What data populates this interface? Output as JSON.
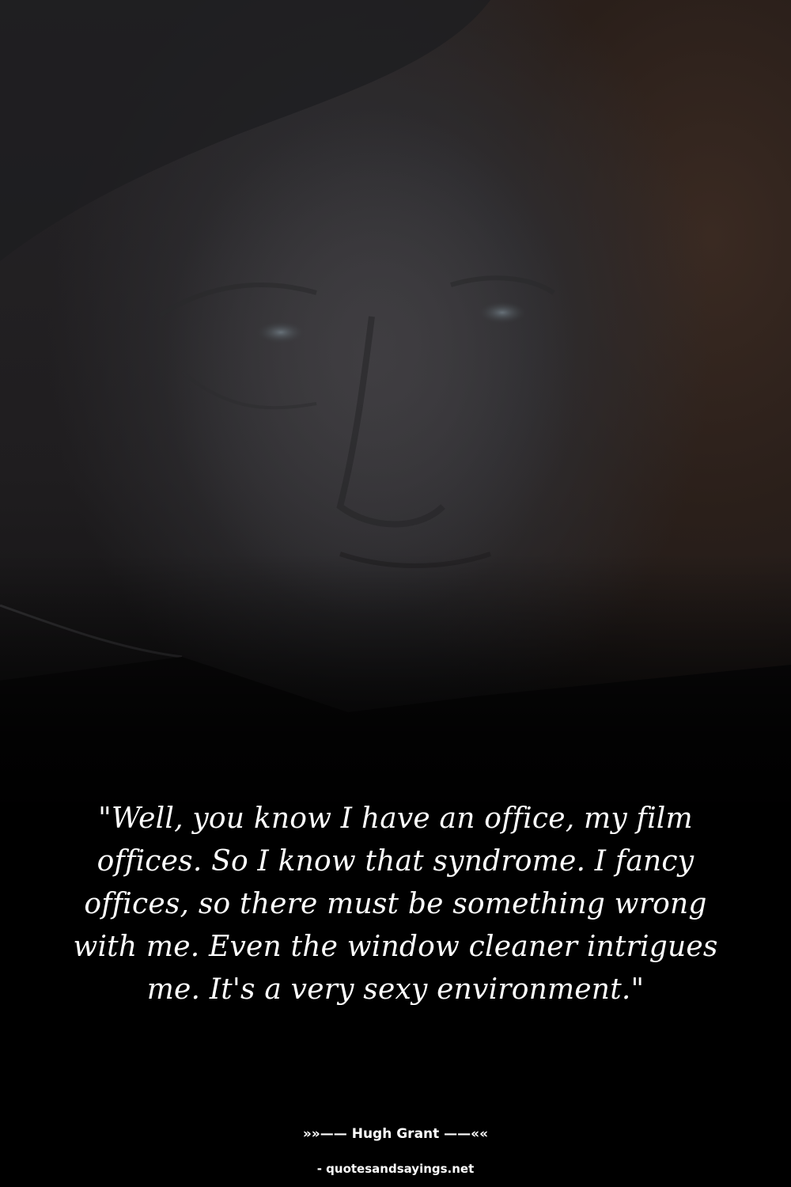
{
  "quote": {
    "text": "\"Well, you know I have an office, my film offices. So I know that syndrome. I fancy offices, so there must be something wrong with me. Even the window cleaner intrigues me. It's a very sexy environment.\"",
    "author_line": "»»—— Hugh Grant ——««",
    "source": "- quotesandsayings.net"
  },
  "background": {
    "image": "dim-portrait-photo",
    "colors": {
      "top": "#262427",
      "warm_right": "#3a2a22",
      "bottom": "#000000",
      "text": "#ffffff"
    }
  }
}
